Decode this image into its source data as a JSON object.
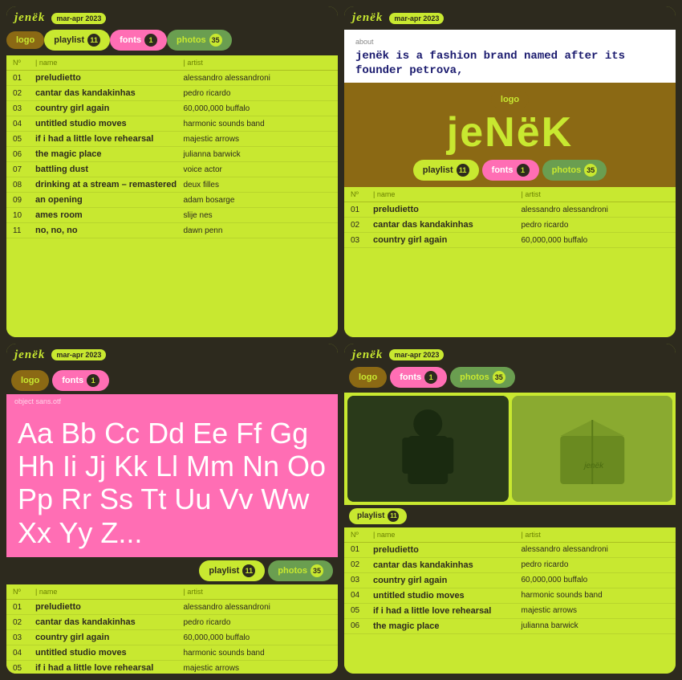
{
  "brand": "jenëk",
  "date_badge": "mar-apr 2023",
  "about_text": "about",
  "tagline": "jenëk is a fashion brand named after its founder petrova,",
  "big_logo": "jeNëK",
  "font_name": "object sans.otf",
  "font_specimen": "Aa Bb Cc Dd Ee Ff Gg Hh Ii Jj Kk Ll Mm Nn Oo Pp Rr Ss Tt Uu Vv Ww Xx Yy Z...",
  "tabs": {
    "logo": "logo",
    "playlist": "playlist",
    "fonts": "fonts",
    "photos": "photos",
    "playlist_count": "11",
    "fonts_count": "1",
    "photos_count": "35"
  },
  "tracks": [
    {
      "num": "01",
      "name": "preludietto",
      "artist": "alessandro alessandroni"
    },
    {
      "num": "02",
      "name": "cantar das kandakinhas",
      "artist": "pedro ricardo"
    },
    {
      "num": "03",
      "name": "country girl again",
      "artist": "60,000,000 buffalo"
    },
    {
      "num": "04",
      "name": "untitled studio moves",
      "artist": "harmonic sounds band"
    },
    {
      "num": "05",
      "name": "if i had a little love rehearsal",
      "artist": "majestic arrows"
    },
    {
      "num": "06",
      "name": "the magic place",
      "artist": "julianna barwick"
    },
    {
      "num": "07",
      "name": "battling dust",
      "artist": "voice actor"
    },
    {
      "num": "08",
      "name": "drinking at a stream – remastered",
      "artist": "deux filles"
    },
    {
      "num": "09",
      "name": "an opening",
      "artist": "adam bosarge"
    },
    {
      "num": "10",
      "name": "ames room",
      "artist": "slije nes"
    },
    {
      "num": "11",
      "name": "no, no, no",
      "artist": "dawn penn"
    }
  ],
  "tracks_short": [
    {
      "num": "01",
      "name": "preludietto",
      "artist": "alessandro alessandroni"
    },
    {
      "num": "02",
      "name": "cantar das kandakinhas",
      "artist": "pedro ricardo"
    },
    {
      "num": "03",
      "name": "country girl again",
      "artist": "60,000,000 buffalo"
    }
  ],
  "tracks_medium": [
    {
      "num": "01",
      "name": "preludietto",
      "artist": "alessandro alessandroni"
    },
    {
      "num": "02",
      "name": "cantar das kandakinhas",
      "artist": "pedro ricardo"
    },
    {
      "num": "03",
      "name": "country girl again",
      "artist": "60,000,000 buffalo"
    },
    {
      "num": "04",
      "name": "untitled studio moves",
      "artist": "harmonic sounds band"
    },
    {
      "num": "05",
      "name": "if i had a little love rehearsal",
      "artist": "majestic arrows"
    },
    {
      "num": "06",
      "name": "the magic place",
      "artist": "julianna barwick"
    }
  ],
  "col_no": "Nº",
  "col_name": "| name",
  "col_artist": "| artist"
}
